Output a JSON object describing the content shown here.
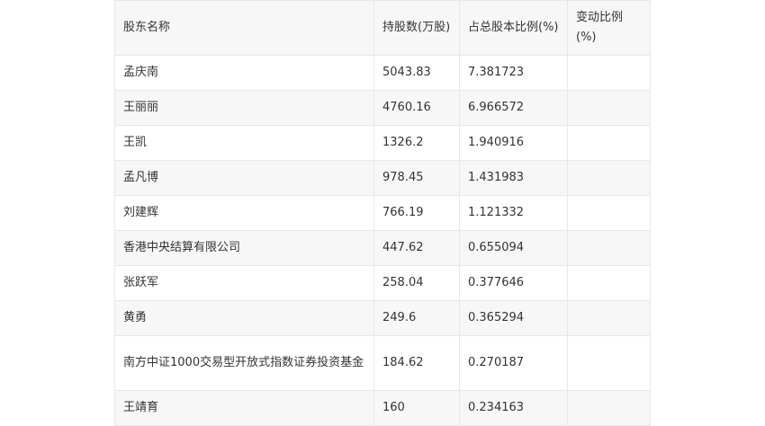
{
  "table": {
    "headers": [
      "股东名称",
      "持股数(万股)",
      "占总股本比例(%)",
      "变动比例(%)"
    ],
    "rows": [
      [
        "孟庆南",
        "5043.83",
        "7.381723",
        ""
      ],
      [
        "王丽丽",
        "4760.16",
        "6.966572",
        ""
      ],
      [
        "王凯",
        "1326.2",
        "1.940916",
        ""
      ],
      [
        "孟凡博",
        "978.45",
        "1.431983",
        ""
      ],
      [
        "刘建辉",
        "766.19",
        "1.121332",
        ""
      ],
      [
        "香港中央结算有限公司",
        "447.62",
        "0.655094",
        ""
      ],
      [
        "张跃军",
        "258.04",
        "0.377646",
        ""
      ],
      [
        "黄勇",
        "249.6",
        "0.365294",
        ""
      ],
      [
        "南方中证1000交易型开放式指数证券投资基金",
        "184.62",
        "0.270187",
        ""
      ],
      [
        "王靖育",
        "160",
        "0.234163",
        ""
      ]
    ]
  }
}
